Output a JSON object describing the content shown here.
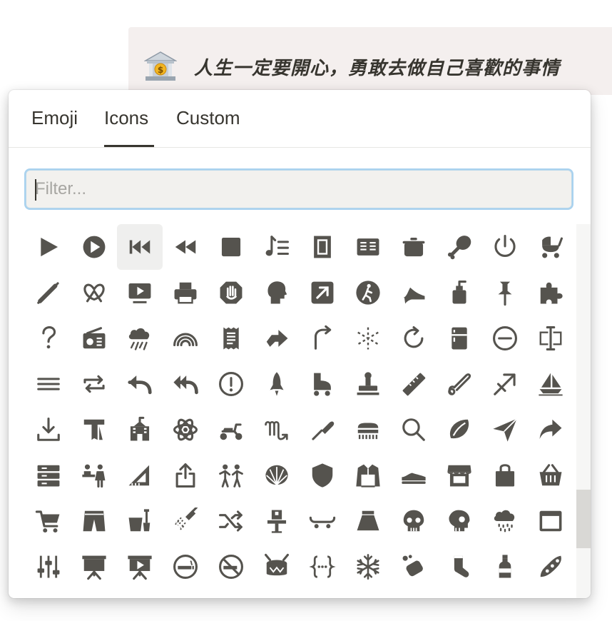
{
  "callout": {
    "emoji": "bank-emoji",
    "text": "人生一定要開心，勇敢去做自己喜歡的事情"
  },
  "picker": {
    "tabs": [
      {
        "label": "Emoji",
        "active": false
      },
      {
        "label": "Icons",
        "active": true
      },
      {
        "label": "Custom",
        "active": false
      }
    ],
    "filter": {
      "placeholder": "Filter...",
      "value": ""
    },
    "icon_color": "#55534e",
    "hover_index": 2,
    "icons": [
      "play",
      "play-circle",
      "skip-back",
      "rewind",
      "stop",
      "playlist",
      "postage-stamp",
      "newspaper",
      "pot",
      "drumstick",
      "power",
      "stroller",
      "pen",
      "pretzel",
      "video-play",
      "printer",
      "hand-stop",
      "head-profile",
      "arrow-up-right-square",
      "pedestrian-circle",
      "high-heel",
      "soap-bottle",
      "pushpin",
      "puzzle",
      "question",
      "radio",
      "rain-cloud",
      "rainbow",
      "receipt",
      "right-arrow",
      "redo",
      "recycle-spark",
      "refresh",
      "refrigerator",
      "remove-circle",
      "rename-cursor",
      "reorder-lines",
      "repeat",
      "reply",
      "reply-all",
      "exclamation-circle",
      "rocket",
      "roller-skate",
      "rubber-stamp",
      "ruler",
      "safety-pin",
      "sagittarius",
      "sailboat",
      "download",
      "scarf",
      "school",
      "science-atom",
      "scooter",
      "scorpio",
      "screwdriver",
      "scrub-brush",
      "search",
      "seed",
      "send-plane",
      "share-arrow",
      "server",
      "service-counter",
      "set-square",
      "share-upload",
      "people-holding",
      "shell",
      "shield",
      "shirt",
      "shoe",
      "shop",
      "shopping-bag",
      "shopping-basket",
      "shopping-cart",
      "shorts",
      "shovel-bucket",
      "shower",
      "shuffle",
      "sink",
      "skateboard",
      "skirt",
      "skull",
      "skull-side",
      "sleet-cloud",
      "slideshow",
      "sliders",
      "presentation",
      "presentation-play",
      "smoking",
      "no-smoking",
      "snare-drum",
      "curly-braces",
      "snowflake",
      "soap",
      "sock",
      "soda-bottle",
      "soybean"
    ]
  }
}
